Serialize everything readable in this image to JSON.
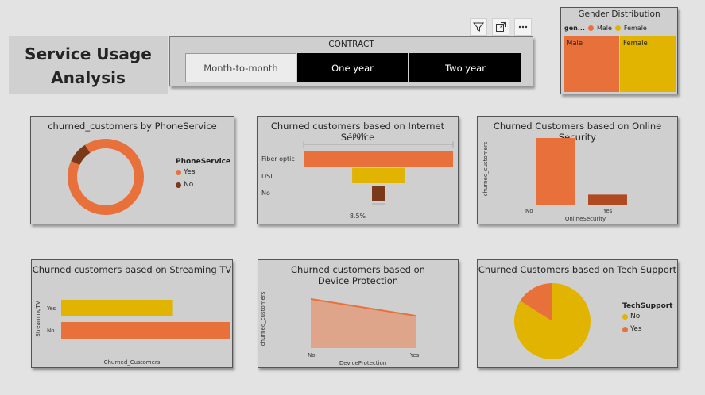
{
  "page": {
    "title_line1": "Service Usage",
    "title_line2": "Analysis"
  },
  "toolbar": {
    "icons": [
      "filter-icon",
      "focus-mode-icon",
      "more-options-icon"
    ]
  },
  "slicer": {
    "title": "CONTRACT",
    "options": [
      {
        "label": "Month-to-month",
        "selected": false
      },
      {
        "label": "One year",
        "selected": true
      },
      {
        "label": "Two year",
        "selected": true
      }
    ]
  },
  "colors": {
    "orange": "#e8703a",
    "gold": "#e0b400",
    "brown": "#7a3a1a",
    "panel": "#cfcfcf"
  },
  "gender": {
    "title": "Gender Distribution",
    "legend_label": "gen...",
    "legend": [
      "Male",
      "Female"
    ],
    "tile_male": "Male",
    "tile_female": "Female"
  },
  "phone": {
    "title": "churned_customers by PhoneService",
    "legend_title": "PhoneService",
    "legend": [
      "Yes",
      "No"
    ]
  },
  "internet": {
    "title": "Churned customers based on Internet Service",
    "top_label": "100%",
    "bottom_label": "8.5%",
    "categories": [
      "Fiber optic",
      "DSL",
      "No"
    ]
  },
  "security": {
    "title": "Churned Customers based on Online Security",
    "ylabel": "churned_customers",
    "xlabel": "OnlineSecurity",
    "categories": [
      "No",
      "Yes"
    ]
  },
  "streaming": {
    "title": "Churned customers based on Streaming TV",
    "ylabel": "StreamingTV",
    "xlabel": "Churned_Customers",
    "categories": [
      "Yes",
      "No"
    ]
  },
  "device": {
    "title": "Churned customers based on Device Protection",
    "ylabel": "churned_customers",
    "xlabel": "DeviceProtection",
    "categories": [
      "No",
      "Yes"
    ]
  },
  "tech": {
    "title": "Churned Customers based on Tech Support",
    "legend_title": "TechSupport",
    "legend": [
      "No",
      "Yes"
    ]
  },
  "chart_data": [
    {
      "type": "pie",
      "title": "Gender Distribution",
      "categories": [
        "Male",
        "Female"
      ],
      "values": [
        50,
        50
      ]
    },
    {
      "type": "pie",
      "title": "churned_customers by PhoneService",
      "categories": [
        "Yes",
        "No"
      ],
      "values": [
        91,
        9
      ]
    },
    {
      "type": "bar",
      "title": "Churned customers based on Internet Service",
      "categories": [
        "Fiber optic",
        "DSL",
        "No"
      ],
      "values": [
        100,
        35,
        8.5
      ]
    },
    {
      "type": "bar",
      "title": "Churned Customers based on Online Security",
      "categories": [
        "No",
        "Yes"
      ],
      "values": [
        100,
        15
      ],
      "xlabel": "OnlineSecurity",
      "ylabel": "churned_customers"
    },
    {
      "type": "bar",
      "title": "Churned customers based on Streaming TV",
      "categories": [
        "Yes",
        "No"
      ],
      "values": [
        66,
        100
      ],
      "xlabel": "Churned_Customers",
      "ylabel": "StreamingTV"
    },
    {
      "type": "area",
      "title": "Churned customers based on Device Protection",
      "categories": [
        "No",
        "Yes"
      ],
      "values": [
        100,
        66
      ],
      "xlabel": "DeviceProtection",
      "ylabel": "churned_customers"
    },
    {
      "type": "pie",
      "title": "Churned Customers based on Tech Support",
      "categories": [
        "No",
        "Yes"
      ],
      "values": [
        84,
        16
      ]
    }
  ]
}
